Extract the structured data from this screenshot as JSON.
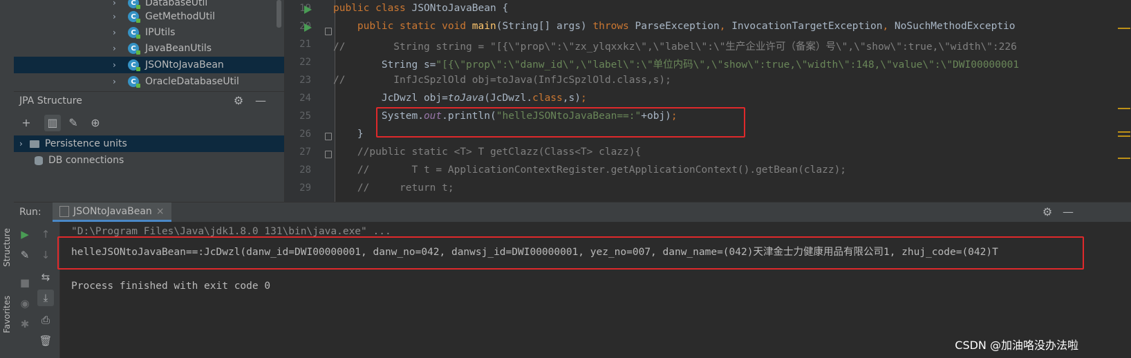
{
  "left_strip": {
    "structure_tab": "Structure",
    "favorites_tab": "Favorites"
  },
  "project_tree": {
    "items": [
      {
        "label": "DatabaseUtil",
        "icon": "class-icon"
      },
      {
        "label": "GetMethodUtil",
        "icon": "class-icon"
      },
      {
        "label": "IPUtils",
        "icon": "class-icon"
      },
      {
        "label": "JavaBeanUtils",
        "icon": "class-icon"
      },
      {
        "label": "JSONtoJavaBean",
        "icon": "class-icon",
        "selected": true
      },
      {
        "label": "OracleDatabaseUtil",
        "icon": "class-icon"
      }
    ],
    "class_icon_letter": "C",
    "chevron": "›"
  },
  "jpa_structure": {
    "title": "JPA Structure",
    "items": [
      {
        "label": "Persistence units",
        "icon": "folder-icon",
        "selected": true
      },
      {
        "label": "DB connections",
        "icon": "database-icon"
      }
    ]
  },
  "editor": {
    "line_numbers": [
      "19",
      "20",
      "21",
      "22",
      "23",
      "24",
      "25",
      "26",
      "27",
      "28",
      "29"
    ],
    "code": {
      "l19": {
        "kw": "public class ",
        "rest": "JSONtoJavaBean {"
      },
      "l20": {
        "kw1": "public static void ",
        "fn": "main",
        "a": "(String[] args) ",
        "kw2": "throws ",
        "b": "ParseException",
        "c": ", ",
        "d": "InvocationTargetException",
        "e": ", ",
        "f": "NoSuchMethodExceptio"
      },
      "l21": {
        "cmt": "//        String string = \"[{\\\"prop\\\":\\\"zx_ylqxxkz\\\",\\\"label\\\":\\\"生产企业许可（备案）号\\\",\\\"show\\\":true,\\\"width\\\":226"
      },
      "l22": {
        "a": "        String s=",
        "str": "\"[{\\\"prop\\\":\\\"danw_id\\\",\\\"label\\\":\\\"单位内码\\\",\\\"show\\\":true,\\\"width\\\":148,\\\"value\\\":\\\"DWI00000001"
      },
      "l23": {
        "cmt": "//        InfJcSpzlOld obj=toJava(InfJcSpzlOld.class,s);"
      },
      "l24": {
        "a": "        JcDwzl obj=",
        "fn": "toJava",
        "b": "(JcDwzl.",
        "kw": "class",
        "c": ",s)",
        "d": ";"
      },
      "l25": {
        "a": "        System.",
        "fld": "out",
        "b": ".println(",
        "str": "\"helleJSONtoJavaBean==:\"",
        "c": "+obj)",
        "d": ";"
      },
      "l26": {
        "a": "    }"
      },
      "l27": {
        "cmt": "    //public static <T> T getClazz(Class<T> clazz){"
      },
      "l28": {
        "cmt": "    //       T t = ApplicationContextRegister.getApplicationContext().getBean(clazz);"
      },
      "l29": {
        "cmt": "    //     return t;"
      }
    }
  },
  "run_window": {
    "label": "Run:",
    "tab_name": "JSONtoJavaBean",
    "tab_close": "×",
    "console": {
      "command": "\"D:\\Program Files\\Java\\jdk1.8.0_131\\bin\\java.exe\" ...",
      "output": "helleJSONtoJavaBean==:JcDwzl(danw_id=DWI00000001, danw_no=042, danwsj_id=DWI00000001, yez_no=007, danw_name=(042)天津金士力健康用品有限公司1, zhuj_code=(042)T",
      "exit": "Process finished with exit code 0"
    }
  },
  "watermark": "CSDN @加油咯没办法啦",
  "colors": {
    "highlight_box": "#e0292b",
    "selection": "#0d293e",
    "run_green": "#499c54"
  }
}
